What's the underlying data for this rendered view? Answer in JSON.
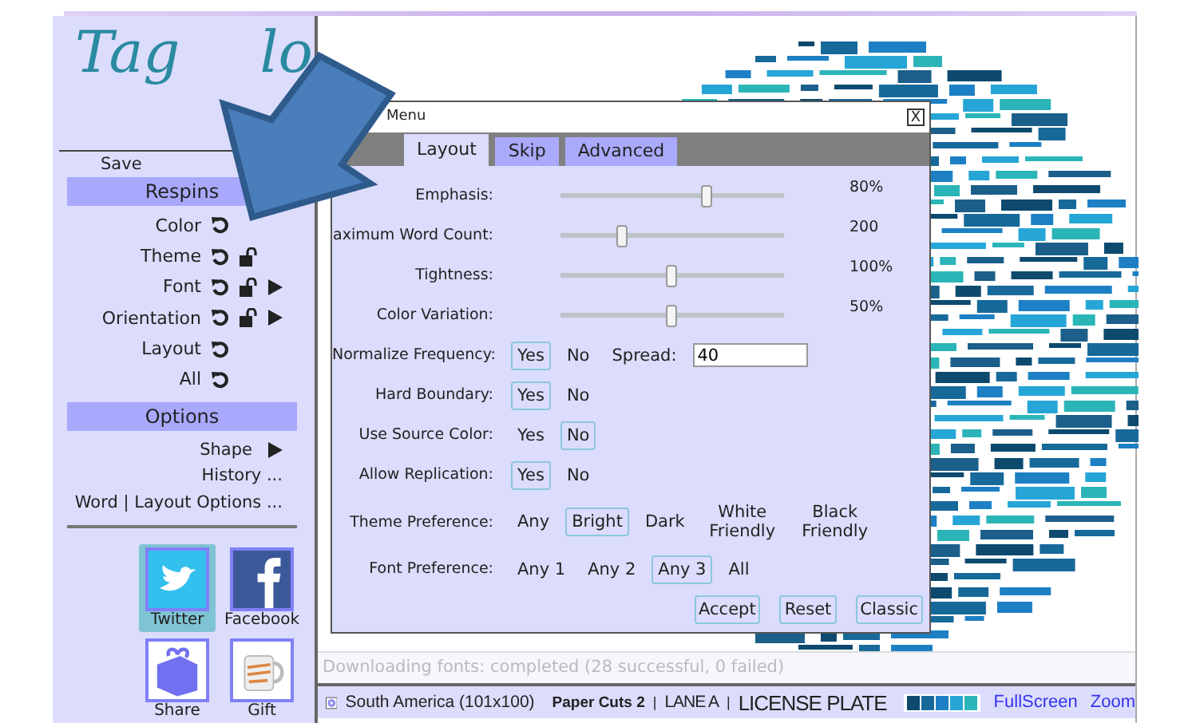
{
  "logo": {
    "parts": [
      "Tag",
      "lo"
    ]
  },
  "save_link": "Save",
  "respins": {
    "title": "Respins",
    "items": [
      {
        "label": "Color",
        "kind": "plain",
        "has_submenu": false
      },
      {
        "label": "Theme",
        "kind": "lockable",
        "locked": false,
        "has_submenu": false
      },
      {
        "label": "Font",
        "kind": "lockable",
        "locked": false,
        "has_submenu": true
      },
      {
        "label": "Orientation",
        "kind": "lockable",
        "locked": false,
        "has_submenu": true
      },
      {
        "label": "Layout",
        "kind": "plain",
        "has_submenu": false
      },
      {
        "label": "All",
        "kind": "plain",
        "has_submenu": false
      }
    ]
  },
  "options": {
    "title": "Options",
    "items": [
      {
        "label": "Shape",
        "has_submenu": true
      },
      {
        "label": "History ...",
        "has_submenu": false
      },
      {
        "label": "Word | Layout Options ...",
        "has_submenu": false
      }
    ]
  },
  "share_buttons": [
    {
      "label": "Twitter",
      "kind": "twitter",
      "selected": true
    },
    {
      "label": "Facebook",
      "kind": "facebook",
      "selected": false
    },
    {
      "label": "Share",
      "kind": "share",
      "selected": false
    },
    {
      "label": "Gift",
      "kind": "gift",
      "selected": false
    }
  ],
  "dialog": {
    "title": "Menu",
    "close": "X",
    "tabs": [
      {
        "label": "Layout",
        "selected": true
      },
      {
        "label": "Skip",
        "selected": false
      },
      {
        "label": "Advanced",
        "selected": false
      }
    ],
    "sliders": [
      {
        "label": "Emphasis:",
        "level": 0.66,
        "reading": "80%"
      },
      {
        "label": "aximum Word Count:",
        "level": 0.28,
        "reading": "200"
      },
      {
        "label": "Tightness:",
        "level": 0.5,
        "reading": "100%"
      },
      {
        "label": "Color Variation:",
        "level": 0.5,
        "reading": "50%"
      }
    ],
    "choices": [
      {
        "label": "Normalize Frequency:",
        "options": [
          {
            "label": "Yes",
            "selected": true
          },
          {
            "label": "No",
            "selected": false
          }
        ],
        "spread": {
          "label": "Spread:",
          "value": "40"
        }
      },
      {
        "label": "Hard Boundary:",
        "options": [
          {
            "label": "Yes",
            "selected": true
          },
          {
            "label": "No",
            "selected": false
          }
        ]
      },
      {
        "label": "Use Source Color:",
        "options": [
          {
            "label": "Yes",
            "selected": false
          },
          {
            "label": "No",
            "selected": true
          }
        ]
      },
      {
        "label": "Allow Replication:",
        "options": [
          {
            "label": "Yes",
            "selected": true
          },
          {
            "label": "No",
            "selected": false
          }
        ]
      },
      {
        "label": "Theme Preference:",
        "options": [
          {
            "label": "Any",
            "selected": false
          },
          {
            "label": "Bright",
            "selected": true
          },
          {
            "label": "Dark",
            "selected": false
          },
          {
            "label": "White Friendly",
            "selected": false
          },
          {
            "label": "Black Friendly",
            "selected": false
          }
        ]
      },
      {
        "label": "Font Preference:",
        "options": [
          {
            "label": "Any 1",
            "selected": false
          },
          {
            "label": "Any 2",
            "selected": false
          },
          {
            "label": "Any 3",
            "selected": true
          },
          {
            "label": "All",
            "selected": false
          }
        ]
      }
    ],
    "buttons": [
      "Accept",
      "Reset",
      "Classic"
    ]
  },
  "status": "Downloading fonts: completed (28 successful, 0 failed)",
  "bottom_bar": {
    "shape_name": "South America (101x100)",
    "fonts": [
      {
        "kind": "font",
        "text": "Paper Cuts 2"
      },
      {
        "kind": "separator",
        "text": "|"
      },
      {
        "kind": "font",
        "text": "LANE A"
      },
      {
        "kind": "separator",
        "text": "|"
      },
      {
        "kind": "font",
        "text": "LICENSE PLATE"
      }
    ],
    "palette": [
      {
        "color": "#0d4a6e"
      },
      {
        "color": "#17699a"
      },
      {
        "color": "#1d80c4"
      },
      {
        "color": "#26a6d6"
      },
      {
        "color": "#2bb5b8"
      }
    ],
    "links": [
      "FullScreen",
      "Zoom"
    ]
  }
}
